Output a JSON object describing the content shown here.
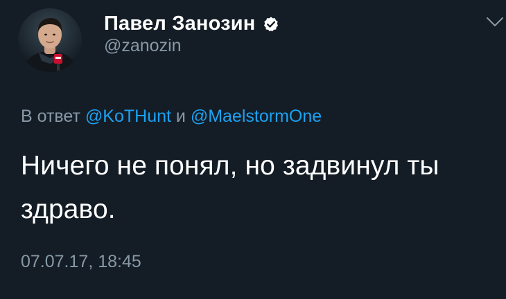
{
  "tweet": {
    "author": {
      "display_name": "Павел Занозин",
      "handle": "@zanozin",
      "verified": true
    },
    "reply_to": {
      "prefix": "В ответ",
      "mention_1": "@KoTHunt",
      "joiner": "и",
      "mention_2": "@MaelstormOne"
    },
    "text": "Ничего не понял, но задвинул ты здраво.",
    "timestamp": "07.07.17, 18:45"
  },
  "colors": {
    "background": "#141d26",
    "text_primary": "#ffffff",
    "text_secondary": "#8899a6",
    "accent": "#1da1f2"
  },
  "icons": {
    "verified": "verified-badge-icon",
    "more": "chevron-down-icon"
  }
}
